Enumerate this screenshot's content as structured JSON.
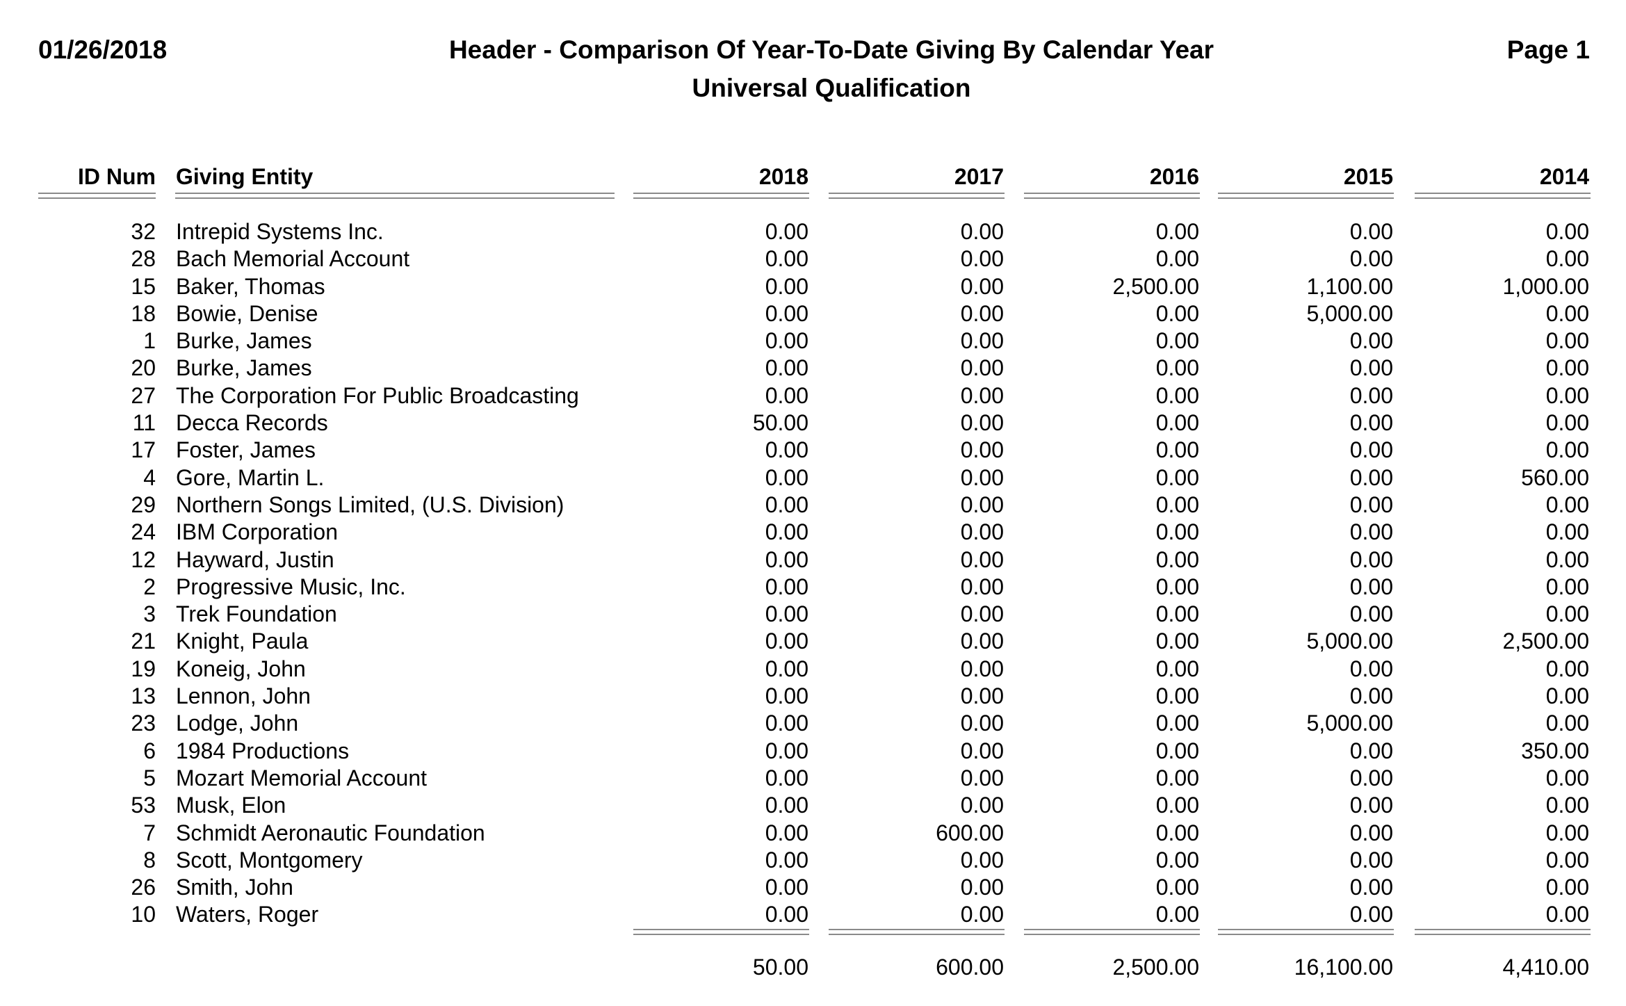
{
  "report": {
    "date": "01/26/2018",
    "title": "Header - Comparison Of Year-To-Date Giving By Calendar Year",
    "subtitle": "Universal Qualification",
    "page": "Page 1"
  },
  "columns": {
    "id": "ID Num",
    "entity": "Giving Entity",
    "years": [
      "2018",
      "2017",
      "2016",
      "2015",
      "2014"
    ]
  },
  "rows": [
    {
      "id": "32",
      "entity": "Intrepid Systems Inc.",
      "values": [
        "0.00",
        "0.00",
        "0.00",
        "0.00",
        "0.00"
      ]
    },
    {
      "id": "28",
      "entity": "Bach Memorial Account",
      "values": [
        "0.00",
        "0.00",
        "0.00",
        "0.00",
        "0.00"
      ]
    },
    {
      "id": "15",
      "entity": "Baker, Thomas",
      "values": [
        "0.00",
        "0.00",
        "2,500.00",
        "1,100.00",
        "1,000.00"
      ]
    },
    {
      "id": "18",
      "entity": "Bowie, Denise",
      "values": [
        "0.00",
        "0.00",
        "0.00",
        "5,000.00",
        "0.00"
      ]
    },
    {
      "id": "1",
      "entity": "Burke, James",
      "values": [
        "0.00",
        "0.00",
        "0.00",
        "0.00",
        "0.00"
      ]
    },
    {
      "id": "20",
      "entity": "Burke, James",
      "values": [
        "0.00",
        "0.00",
        "0.00",
        "0.00",
        "0.00"
      ]
    },
    {
      "id": "27",
      "entity": "The Corporation For Public Broadcasting",
      "values": [
        "0.00",
        "0.00",
        "0.00",
        "0.00",
        "0.00"
      ]
    },
    {
      "id": "11",
      "entity": "Decca Records",
      "values": [
        "50.00",
        "0.00",
        "0.00",
        "0.00",
        "0.00"
      ]
    },
    {
      "id": "17",
      "entity": "Foster, James",
      "values": [
        "0.00",
        "0.00",
        "0.00",
        "0.00",
        "0.00"
      ]
    },
    {
      "id": "4",
      "entity": "Gore, Martin L.",
      "values": [
        "0.00",
        "0.00",
        "0.00",
        "0.00",
        "560.00"
      ]
    },
    {
      "id": "29",
      "entity": "Northern Songs Limited, (U.S. Division)",
      "values": [
        "0.00",
        "0.00",
        "0.00",
        "0.00",
        "0.00"
      ]
    },
    {
      "id": "24",
      "entity": "IBM Corporation",
      "values": [
        "0.00",
        "0.00",
        "0.00",
        "0.00",
        "0.00"
      ]
    },
    {
      "id": "12",
      "entity": "Hayward, Justin",
      "values": [
        "0.00",
        "0.00",
        "0.00",
        "0.00",
        "0.00"
      ]
    },
    {
      "id": "2",
      "entity": "Progressive Music, Inc.",
      "values": [
        "0.00",
        "0.00",
        "0.00",
        "0.00",
        "0.00"
      ]
    },
    {
      "id": "3",
      "entity": "Trek Foundation",
      "values": [
        "0.00",
        "0.00",
        "0.00",
        "0.00",
        "0.00"
      ]
    },
    {
      "id": "21",
      "entity": "Knight, Paula",
      "values": [
        "0.00",
        "0.00",
        "0.00",
        "5,000.00",
        "2,500.00"
      ]
    },
    {
      "id": "19",
      "entity": "Koneig, John",
      "values": [
        "0.00",
        "0.00",
        "0.00",
        "0.00",
        "0.00"
      ]
    },
    {
      "id": "13",
      "entity": "Lennon, John",
      "values": [
        "0.00",
        "0.00",
        "0.00",
        "0.00",
        "0.00"
      ]
    },
    {
      "id": "23",
      "entity": "Lodge, John",
      "values": [
        "0.00",
        "0.00",
        "0.00",
        "5,000.00",
        "0.00"
      ]
    },
    {
      "id": "6",
      "entity": "1984 Productions",
      "values": [
        "0.00",
        "0.00",
        "0.00",
        "0.00",
        "350.00"
      ]
    },
    {
      "id": "5",
      "entity": "Mozart Memorial Account",
      "values": [
        "0.00",
        "0.00",
        "0.00",
        "0.00",
        "0.00"
      ]
    },
    {
      "id": "53",
      "entity": "Musk, Elon",
      "values": [
        "0.00",
        "0.00",
        "0.00",
        "0.00",
        "0.00"
      ]
    },
    {
      "id": "7",
      "entity": "Schmidt Aeronautic Foundation",
      "values": [
        "0.00",
        "600.00",
        "0.00",
        "0.00",
        "0.00"
      ]
    },
    {
      "id": "8",
      "entity": "Scott, Montgomery",
      "values": [
        "0.00",
        "0.00",
        "0.00",
        "0.00",
        "0.00"
      ]
    },
    {
      "id": "26",
      "entity": "Smith, John",
      "values": [
        "0.00",
        "0.00",
        "0.00",
        "0.00",
        "0.00"
      ]
    },
    {
      "id": "10",
      "entity": "Waters, Roger",
      "values": [
        "0.00",
        "0.00",
        "0.00",
        "0.00",
        "0.00"
      ]
    }
  ],
  "totals": [
    "50.00",
    "600.00",
    "2,500.00",
    "16,100.00",
    "4,410.00"
  ],
  "colors": {
    "text": "#000000",
    "rule": "#8a8a8a",
    "background": "#ffffff"
  }
}
